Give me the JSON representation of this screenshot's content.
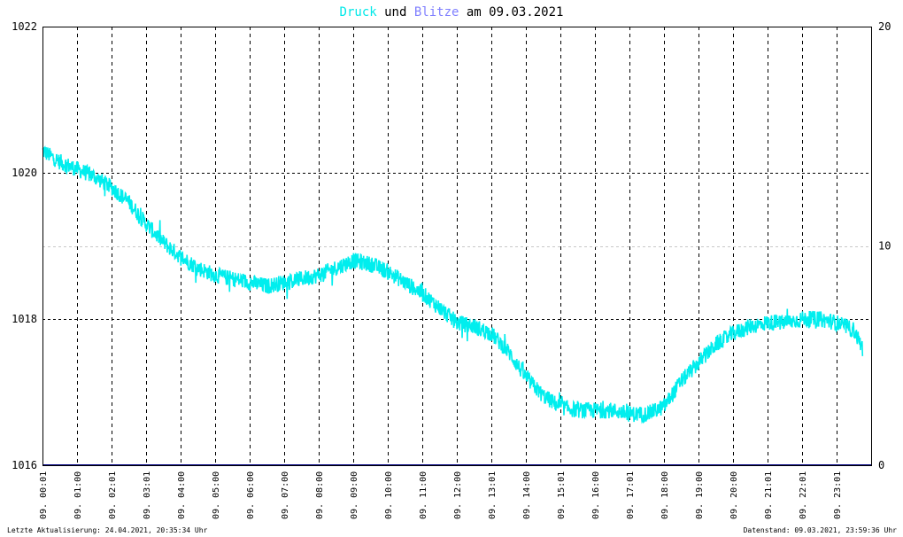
{
  "title": {
    "word1": "Druck",
    "word2": " und ",
    "word3": "Blitze",
    "word4": " am 09.03.2021",
    "color1": "#00e8e8",
    "color3": "#8080ff",
    "color_text": "#000000"
  },
  "footer": {
    "left": "Letzte Aktualisierung: 24.04.2021, 20:35:34 Uhr",
    "right": "Datenstand: 09.03.2021, 23:59:36 Uhr"
  },
  "chart_data": {
    "type": "line",
    "xlim": [
      0,
      24
    ],
    "y_left": {
      "min": 1016,
      "max": 1022,
      "ticks": [
        "1016",
        "1018",
        "1020",
        "1022"
      ]
    },
    "y_right": {
      "min": 0,
      "max": 20,
      "ticks": [
        "0",
        "10",
        "20"
      ]
    },
    "x_tick_labels": [
      "09. 00:01",
      "09. 01:00",
      "09. 02:01",
      "09. 03:01",
      "09. 04:00",
      "09. 05:00",
      "09. 06:00",
      "09. 07:00",
      "09. 08:00",
      "09. 09:00",
      "09. 10:00",
      "09. 11:00",
      "09. 12:00",
      "09. 13:01",
      "09. 14:00",
      "09. 15:01",
      "09. 16:00",
      "09. 17:01",
      "09. 18:00",
      "09. 19:00",
      "09. 20:00",
      "09. 21:01",
      "09. 22:01",
      "09. 23:01"
    ],
    "x_tick_hours": [
      0.0,
      1.0,
      2.0,
      3.0,
      4.0,
      5.0,
      6.0,
      7.0,
      8.0,
      9.0,
      10.0,
      11.0,
      12.0,
      13.0,
      14.0,
      15.0,
      16.0,
      17.0,
      18.0,
      19.0,
      20.0,
      21.0,
      22.0,
      23.0
    ],
    "grid": true,
    "series": [
      {
        "color": "#00eeee",
        "axis": "left",
        "x": [
          0.0,
          0.5,
          1.0,
          1.5,
          2.0,
          2.5,
          3.0,
          3.5,
          4.0,
          4.5,
          5.0,
          5.5,
          6.0,
          6.5,
          7.0,
          7.5,
          8.0,
          8.5,
          9.0,
          9.5,
          10.0,
          10.5,
          11.0,
          11.5,
          12.0,
          12.5,
          13.0,
          13.5,
          14.0,
          14.5,
          15.0,
          15.5,
          16.0,
          16.5,
          17.0,
          17.5,
          18.0,
          18.5,
          19.0,
          19.5,
          20.0,
          20.5,
          21.0,
          21.5,
          22.0,
          22.5,
          23.0,
          23.5,
          23.75
        ],
        "y": [
          1020.3,
          1020.15,
          1020.05,
          1019.95,
          1019.8,
          1019.6,
          1019.3,
          1019.05,
          1018.85,
          1018.7,
          1018.6,
          1018.55,
          1018.5,
          1018.45,
          1018.5,
          1018.55,
          1018.6,
          1018.7,
          1018.8,
          1018.75,
          1018.65,
          1018.5,
          1018.35,
          1018.15,
          1017.95,
          1017.9,
          1017.8,
          1017.55,
          1017.2,
          1016.95,
          1016.8,
          1016.75,
          1016.75,
          1016.75,
          1016.7,
          1016.7,
          1016.8,
          1017.15,
          1017.4,
          1017.65,
          1017.8,
          1017.9,
          1017.95,
          1017.95,
          1018.0,
          1018.0,
          1017.95,
          1017.85,
          1017.6
        ]
      },
      {
        "color": "#000080",
        "axis": "right",
        "x": [
          0,
          24
        ],
        "y": [
          0,
          0
        ]
      }
    ]
  }
}
